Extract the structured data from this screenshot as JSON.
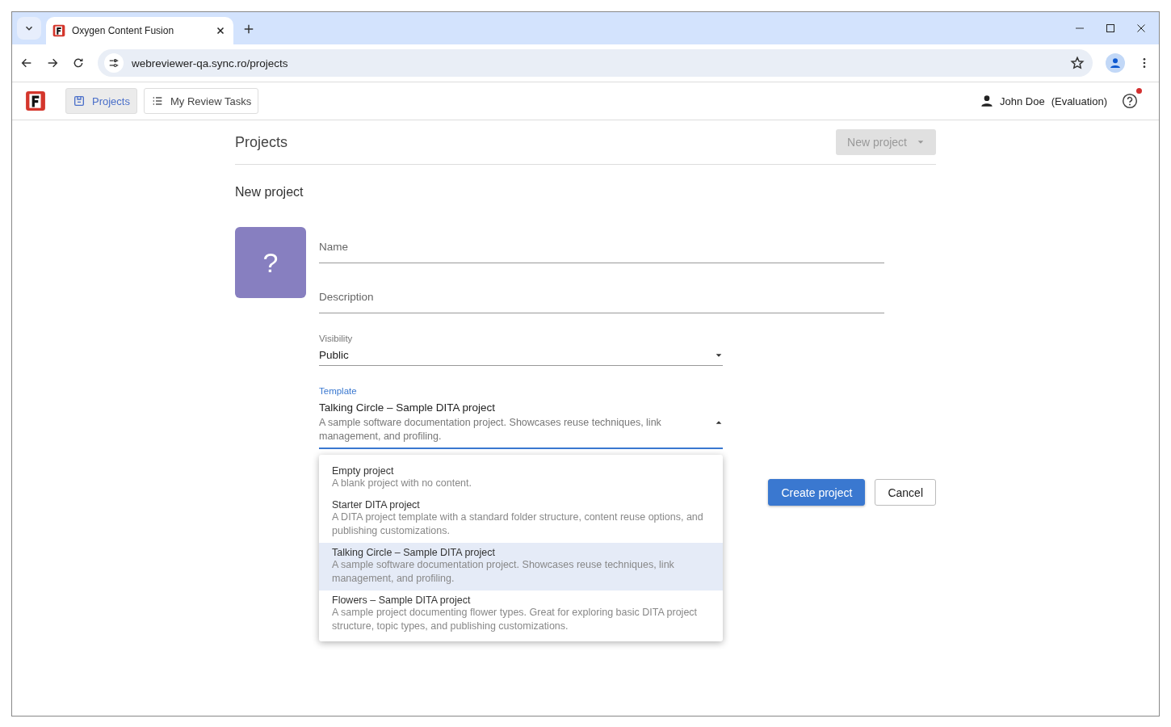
{
  "browser": {
    "tab_title": "Oxygen Content Fusion",
    "url": "webreviewer-qa.sync.ro/projects"
  },
  "nav": [
    {
      "label": "Projects",
      "selected": true,
      "kind": "projects"
    },
    {
      "label": "My Review Tasks",
      "selected": false,
      "kind": "tasks"
    }
  ],
  "user": {
    "name": "John Doe",
    "note": "(Evaluation)",
    "help_notification": true
  },
  "page": {
    "title": "Projects",
    "new_project_button": {
      "label": "New project",
      "disabled": true
    }
  },
  "form": {
    "title": "New project",
    "avatar_glyph": "?",
    "name": {
      "placeholder": "Name"
    },
    "description": {
      "placeholder": "Description"
    },
    "visibility": {
      "label": "Visibility",
      "value": "Public"
    },
    "template": {
      "label": "Template",
      "value": "Talking Circle – Sample DITA project",
      "value_description": "A sample software documentation project. Showcases reuse techniques, link management, and profiling.",
      "expanded": true,
      "options": [
        {
          "title": "Empty project",
          "description": "A blank project with no content.",
          "selected": false
        },
        {
          "title": "Starter DITA project",
          "description": "A DITA project template with a standard folder structure, content reuse options, and publishing customizations.",
          "selected": false
        },
        {
          "title": "Talking Circle – Sample DITA project",
          "description": "A sample software documentation project. Showcases reuse techniques, link management, and profiling.",
          "selected": true
        },
        {
          "title": "Flowers – Sample DITA project",
          "description": "A sample project documenting flower types. Great for exploring basic DITA project structure, topic types, and publishing customizations.",
          "selected": false
        }
      ]
    },
    "buttons": [
      {
        "label": "Create project",
        "kind": "primary"
      },
      {
        "label": "Cancel",
        "kind": "secondary"
      }
    ]
  }
}
